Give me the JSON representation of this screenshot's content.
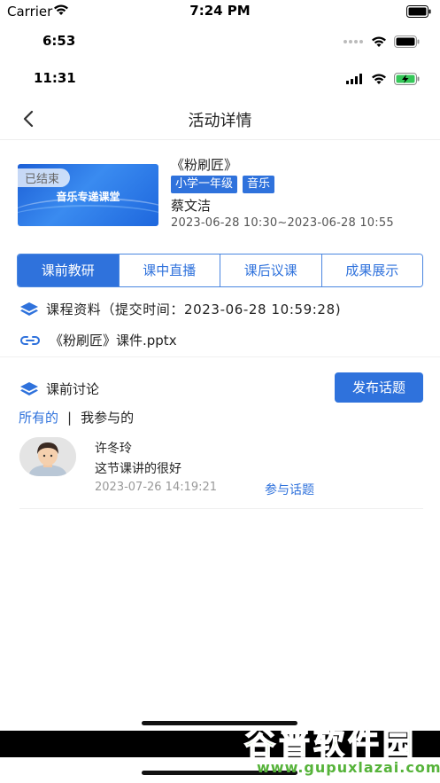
{
  "status_bar_1": {
    "carrier": "Carrier",
    "time": "7:24 PM"
  },
  "status_bar_2": {
    "time": "6:53"
  },
  "status_bar_3": {
    "time": "11:31"
  },
  "navbar": {
    "title": "活动详情",
    "back_icon": "chevron-left-icon"
  },
  "course": {
    "cover_badge": "已结束",
    "cover_text": "音乐专递课堂",
    "title": "《粉刷匠》",
    "tags": [
      "小学一年级",
      "音乐"
    ],
    "teacher": "蔡文洁",
    "time": "2023-06-28 10:30~2023-06-28 10:55"
  },
  "tabs": [
    {
      "label": "课前教研",
      "active": true
    },
    {
      "label": "课中直播",
      "active": false
    },
    {
      "label": "课后议课",
      "active": false
    },
    {
      "label": "成果展示",
      "active": false
    }
  ],
  "materials": {
    "heading": "课程资料（提交时间：2023-06-28 10:59:28)",
    "file_name": "《粉刷匠》课件.pptx"
  },
  "discussion": {
    "heading": "课前讨论",
    "publish_label": "发布话题",
    "filter_all": "所有的",
    "filter_sep": "|",
    "filter_mine": "我参与的",
    "posts": [
      {
        "user": "许冬玲",
        "content": "这节课讲的很好",
        "time": "2023-07-26 14:19:21",
        "action": "参与话题"
      }
    ]
  },
  "watermark": {
    "title": "谷普软件园",
    "url": "www.gupuxlazai.com"
  },
  "colors": {
    "accent": "#2f72dc",
    "watermark": "#56b33a"
  }
}
